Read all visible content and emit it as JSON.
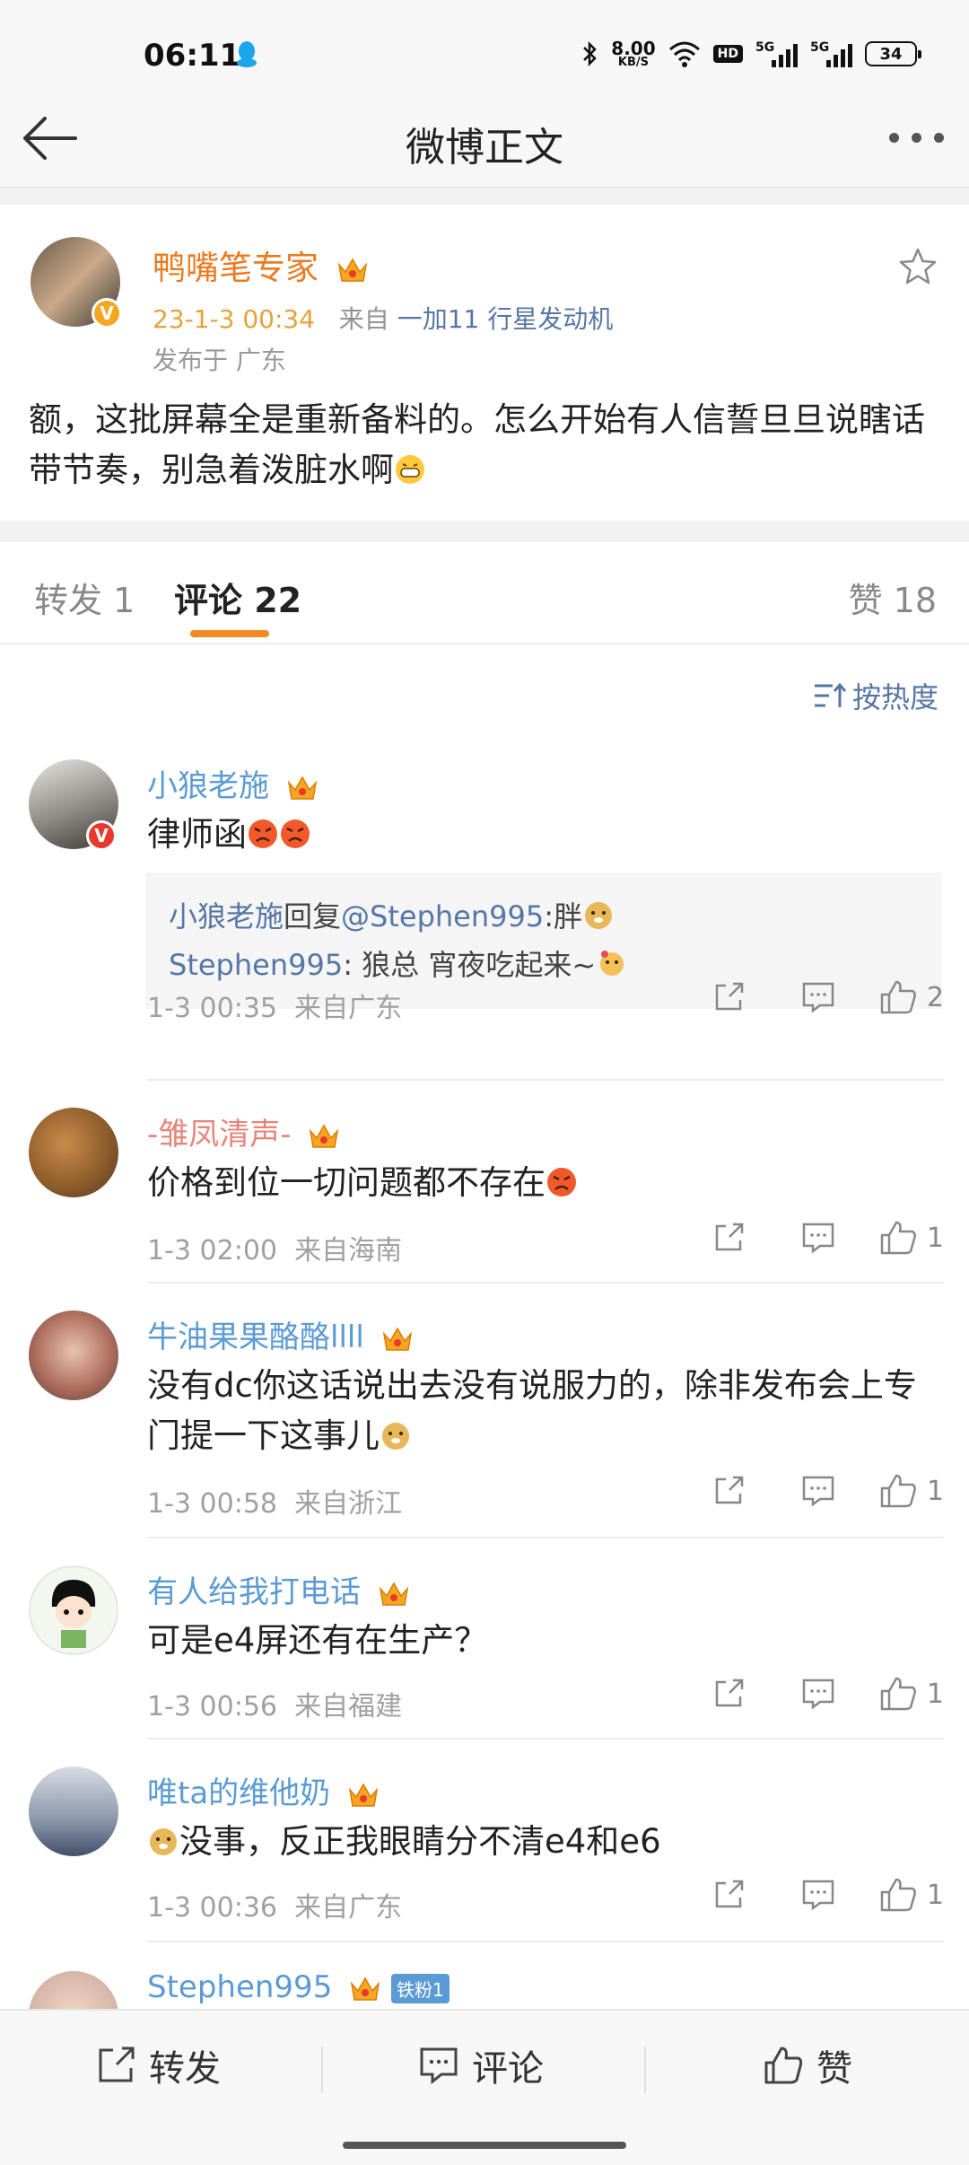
{
  "status_bar": {
    "time": "06:11",
    "net_speed": "8.00",
    "net_unit": "KB/S",
    "hd": "HD",
    "sig1": "5G",
    "sig2": "5G",
    "battery": "34"
  },
  "nav": {
    "title": "微博正文"
  },
  "post": {
    "author": "鸭嘴笔专家",
    "time": "23-1-3 00:34",
    "from_label": "来自",
    "device": "一加11 行星发动机",
    "location": "发布于 广东",
    "text": "额，这批屏幕全是重新备料的。怎么开始有人信誓旦旦说瞎话带节奏，别急着泼脏水啊"
  },
  "tabs": {
    "repost": "转发 1",
    "comments": "评论 22",
    "likes": "赞 18"
  },
  "sort_label": "按热度",
  "comments": [
    {
      "name": "小狼老施",
      "text": "律师函",
      "time": "1-3 00:35",
      "source": "来自广东",
      "likes": "2",
      "replies": [
        {
          "name": "小狼老施",
          "mid": "回复",
          "mention": "@Stephen995",
          "text": ":胖"
        },
        {
          "name": "Stephen995",
          "text": ": 狼总 宵夜吃起来~"
        }
      ]
    },
    {
      "name": "-雏凤清声-",
      "text": "价格到位一切问题都不存在",
      "time": "1-3 02:00",
      "source": "来自海南",
      "likes": "1"
    },
    {
      "name": "牛油果果酪酪llll",
      "text": "没有dc你这话说出去没有说服力的，除非发布会上专门提一下这事儿",
      "time": "1-3 00:58",
      "source": "来自浙江",
      "likes": "1"
    },
    {
      "name": "有人给我打电话",
      "text": "可是e4屏还有在生产？",
      "time": "1-3 00:56",
      "source": "来自福建",
      "likes": "1"
    },
    {
      "name": "唯ta的维他奶",
      "text": "没事，反正我眼睛分不清e4和e6",
      "time": "1-3 00:36",
      "source": "来自广东",
      "likes": "1"
    },
    {
      "name": "Stephen995",
      "badge": "铁粉1"
    }
  ],
  "bottom_bar": {
    "repost": "转发",
    "comment": "评论",
    "like": "赞"
  },
  "colors": {
    "accent_orange": "#f08a24",
    "link_blue": "#5677a6",
    "name_blue": "#5b9bd5",
    "author_orange": "#ec7a1e"
  }
}
